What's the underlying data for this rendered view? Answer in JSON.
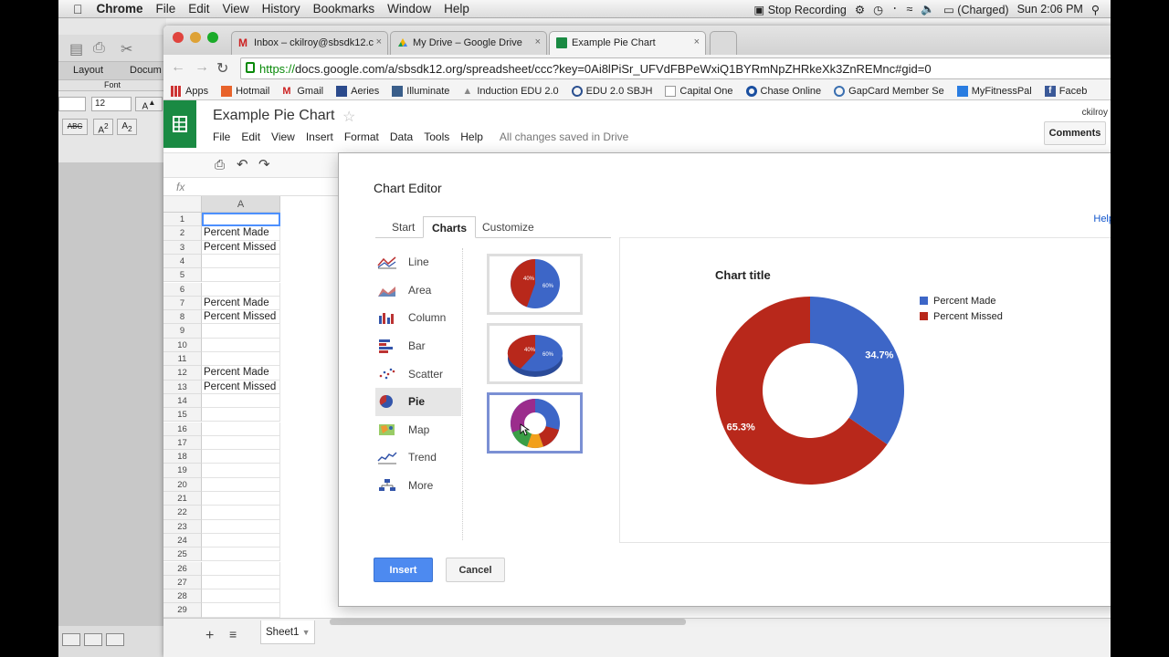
{
  "menubar": {
    "app": "Chrome",
    "items": [
      "File",
      "Edit",
      "View",
      "History",
      "Bookmarks",
      "Window",
      "Help"
    ],
    "stop_recording": "Stop Recording",
    "battery": "(Charged)",
    "clock": "Sun 2:06 PM"
  },
  "word_window": {
    "tabs": [
      "Layout",
      "Docum"
    ],
    "font_label": "Font",
    "font_size": "12"
  },
  "browser": {
    "tabs": [
      {
        "label": "Inbox – ckilroy@sbsdk12.c"
      },
      {
        "label": "My Drive – Google Drive"
      },
      {
        "label": "Example Pie Chart"
      }
    ],
    "url_scheme": "https://",
    "url_rest": "docs.google.com/a/sbsdk12.org/spreadsheet/ccc?key=0Ai8lPiSr_UFVdFBPeWxiQ1BYRmNpZHRkeXk3ZnREMnc#gid=0",
    "bookmarks": [
      "Apps",
      "Hotmail",
      "Gmail",
      "Aeries",
      "Illuminate",
      "Induction EDU 2.0",
      "EDU 2.0 SBJH",
      "Capital One",
      "Chase Online",
      "GapCard Member Se",
      "MyFitnessPal",
      "Faceb"
    ]
  },
  "docs": {
    "title": "Example Pie Chart",
    "menu": [
      "File",
      "Edit",
      "View",
      "Insert",
      "Format",
      "Data",
      "Tools",
      "Help"
    ],
    "saved_status": "All changes saved in Drive",
    "account": "ckilroy",
    "comments_label": "Comments",
    "fx_label": "fx",
    "column_header": "A",
    "rows": [
      "1",
      "2",
      "3",
      "4",
      "5",
      "6",
      "7",
      "8",
      "9",
      "10",
      "11",
      "12",
      "13",
      "14",
      "15",
      "16",
      "17",
      "18",
      "19",
      "20",
      "21",
      "22",
      "23",
      "24",
      "25",
      "26",
      "27",
      "28",
      "29"
    ],
    "cells": {
      "r2": "Percent Made",
      "r3": "Percent Missed",
      "r7": "Percent Made",
      "r8": "Percent Missed",
      "r12": "Percent Made",
      "r13": "Percent Missed"
    },
    "sheet_tab": "Sheet1"
  },
  "chart_editor": {
    "title": "Chart Editor",
    "help": "Help",
    "tabs": [
      "Start",
      "Charts",
      "Customize"
    ],
    "selected_tab": "Charts",
    "chart_types": [
      "Line",
      "Area",
      "Column",
      "Bar",
      "Scatter",
      "Pie",
      "Map",
      "Trend",
      "More"
    ],
    "selected_type": "Pie",
    "thumb_labels": {
      "a": "40%",
      "b": "60%"
    },
    "insert_label": "Insert",
    "cancel_label": "Cancel",
    "colors": {
      "made": "#3d66c7",
      "missed": "#b8281b",
      "insert": "#4d8af0"
    }
  },
  "chart_data": {
    "type": "pie",
    "title": "Chart title",
    "donut": true,
    "categories": [
      "Percent Made",
      "Percent Missed"
    ],
    "values": [
      34.7,
      65.3
    ],
    "labels": [
      "34.7%",
      "65.3%"
    ],
    "legend": "right"
  }
}
